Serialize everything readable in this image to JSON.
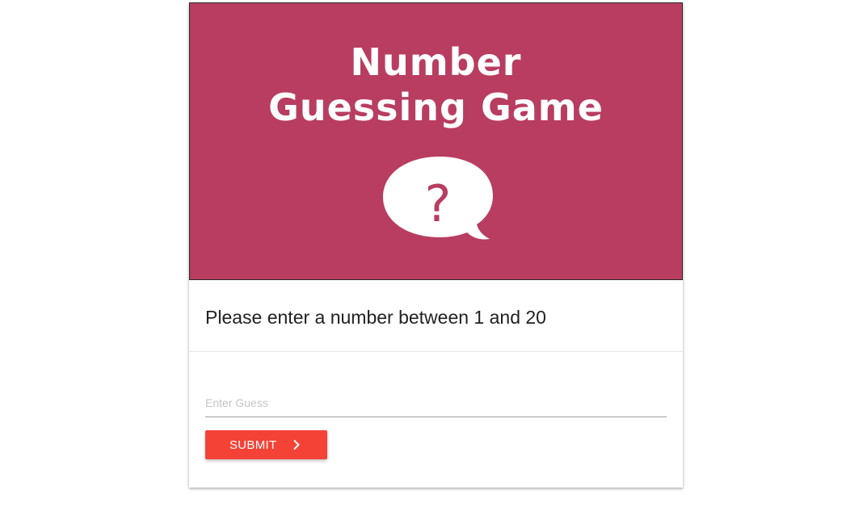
{
  "banner": {
    "title_line1": "Number",
    "title_line2": "Guessing Game",
    "bubble_symbol": "?",
    "background_color": "#b83d61",
    "bubble_icon": "speech-bubble-question-icon"
  },
  "prompt": {
    "text": "Please enter a number between 1 and 20"
  },
  "guess": {
    "value": "",
    "placeholder": "Enter Guess"
  },
  "submit": {
    "label": "SUBMIT",
    "icon": "chevron-right-icon",
    "color": "#f44336"
  }
}
